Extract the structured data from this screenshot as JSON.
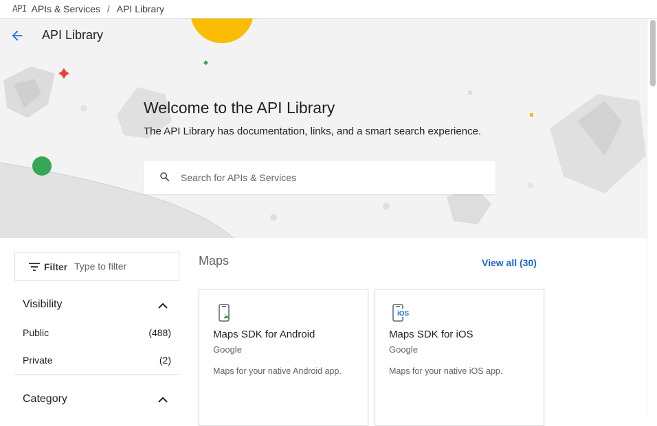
{
  "breadcrumb": {
    "logo_text": "API",
    "items": [
      "APIs & Services",
      "API Library"
    ],
    "separator": "/"
  },
  "header": {
    "title": "API Library"
  },
  "hero": {
    "heading": "Welcome to the API Library",
    "subheading": "The API Library has documentation, links, and a smart search experience.",
    "search_placeholder": "Search for APIs & Services"
  },
  "filter": {
    "label": "Filter",
    "placeholder": "Type to filter"
  },
  "facets": {
    "visibility": {
      "title": "Visibility",
      "items": [
        {
          "label": "Public",
          "count": "(488)"
        },
        {
          "label": "Private",
          "count": "(2)"
        }
      ]
    },
    "category": {
      "title": "Category"
    }
  },
  "section": {
    "title": "Maps",
    "view_all": "View all (30)"
  },
  "cards": [
    {
      "title": "Maps SDK for Android",
      "vendor": "Google",
      "description": "Maps for your native Android app.",
      "icon": "android-phone-icon"
    },
    {
      "title": "Maps SDK for iOS",
      "vendor": "Google",
      "description": "Maps for your native iOS app.",
      "icon": "ios-phone-icon",
      "icon_text": "iOS"
    }
  ],
  "colors": {
    "accent": "#1967d2",
    "hero_bg": "#f3f3f3",
    "sun": "#fbbc04",
    "green_dot": "#34a853",
    "red_star": "#ea4335"
  }
}
